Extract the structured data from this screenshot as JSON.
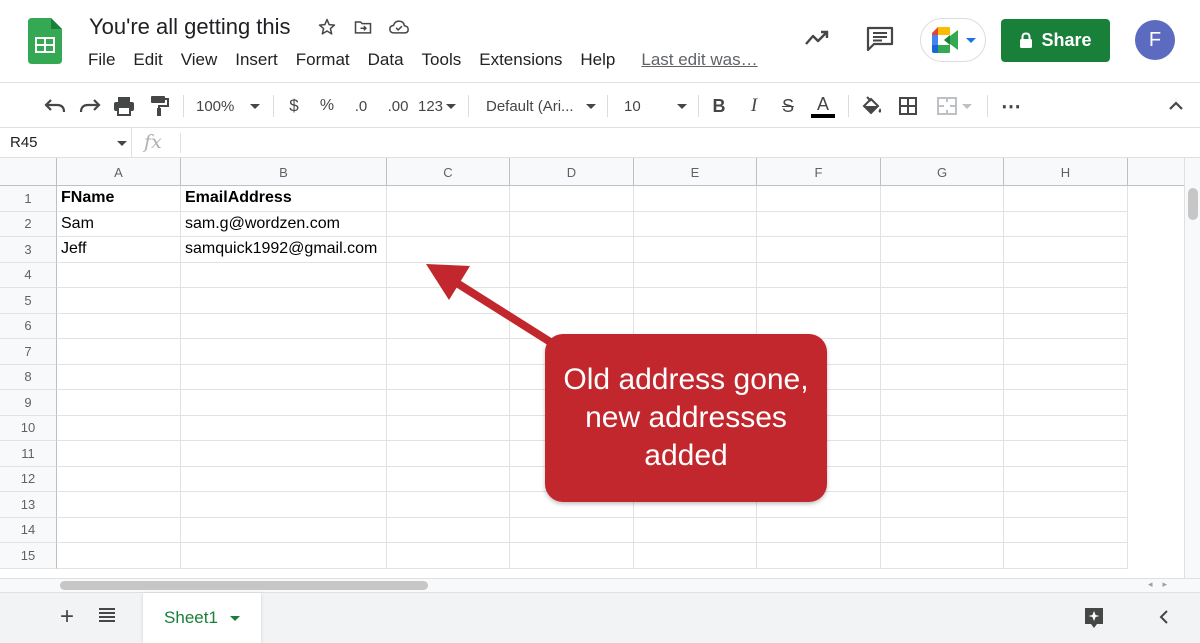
{
  "app": {
    "title": "You're all getting this",
    "last_edit": "Last edit was…"
  },
  "menu": [
    "File",
    "Edit",
    "View",
    "Insert",
    "Format",
    "Data",
    "Tools",
    "Extensions",
    "Help"
  ],
  "header": {
    "share_label": "Share",
    "avatar_initial": "F"
  },
  "toolbar": {
    "zoom": "100%",
    "currency": "$",
    "percent": "%",
    "decimal_decrease": ".0",
    "decimal_increase": ".00",
    "more_formats": "123",
    "font": "Default (Ari...",
    "font_size": "10",
    "bold": "B",
    "italic": "I",
    "strike": "S",
    "text_color": "A",
    "more": "⋯"
  },
  "formula_bar": {
    "name_box": "R45",
    "fx": "fx"
  },
  "columns": [
    "A",
    "B",
    "C",
    "D",
    "E",
    "F",
    "G",
    "H"
  ],
  "rows": [
    {
      "num": "1",
      "cells": [
        "FName",
        "EmailAddress",
        "",
        "",
        "",
        "",
        "",
        ""
      ],
      "bold": true
    },
    {
      "num": "2",
      "cells": [
        "Sam",
        "sam.g@wordzen.com",
        "",
        "",
        "",
        "",
        "",
        ""
      ]
    },
    {
      "num": "3",
      "cells": [
        "Jeff",
        "samquick1992@gmail.com",
        "",
        "",
        "",
        "",
        "",
        ""
      ]
    },
    {
      "num": "4",
      "cells": [
        "",
        "",
        "",
        "",
        "",
        "",
        "",
        ""
      ]
    },
    {
      "num": "5",
      "cells": [
        "",
        "",
        "",
        "",
        "",
        "",
        "",
        ""
      ]
    },
    {
      "num": "6",
      "cells": [
        "",
        "",
        "",
        "",
        "",
        "",
        "",
        ""
      ]
    },
    {
      "num": "7",
      "cells": [
        "",
        "",
        "",
        "",
        "",
        "",
        "",
        ""
      ]
    },
    {
      "num": "8",
      "cells": [
        "",
        "",
        "",
        "",
        "",
        "",
        "",
        ""
      ]
    },
    {
      "num": "9",
      "cells": [
        "",
        "",
        "",
        "",
        "",
        "",
        "",
        ""
      ]
    },
    {
      "num": "10",
      "cells": [
        "",
        "",
        "",
        "",
        "",
        "",
        "",
        ""
      ]
    },
    {
      "num": "11",
      "cells": [
        "",
        "",
        "",
        "",
        "",
        "",
        "",
        ""
      ]
    },
    {
      "num": "12",
      "cells": [
        "",
        "",
        "",
        "",
        "",
        "",
        "",
        ""
      ]
    },
    {
      "num": "13",
      "cells": [
        "",
        "",
        "",
        "",
        "",
        "",
        "",
        ""
      ]
    },
    {
      "num": "14",
      "cells": [
        "",
        "",
        "",
        "",
        "",
        "",
        "",
        ""
      ]
    },
    {
      "num": "15",
      "cells": [
        "",
        "",
        "",
        "",
        "",
        "",
        "",
        ""
      ]
    }
  ],
  "sheets": [
    {
      "label": "Sheet1",
      "active": true
    }
  ],
  "callout": {
    "text": "Old address gone, new addresses added",
    "color": "#c1272d"
  },
  "colors": {
    "share": "#188038",
    "avatar": "#5c6bc0",
    "sheet_tab_text": "#188038"
  }
}
